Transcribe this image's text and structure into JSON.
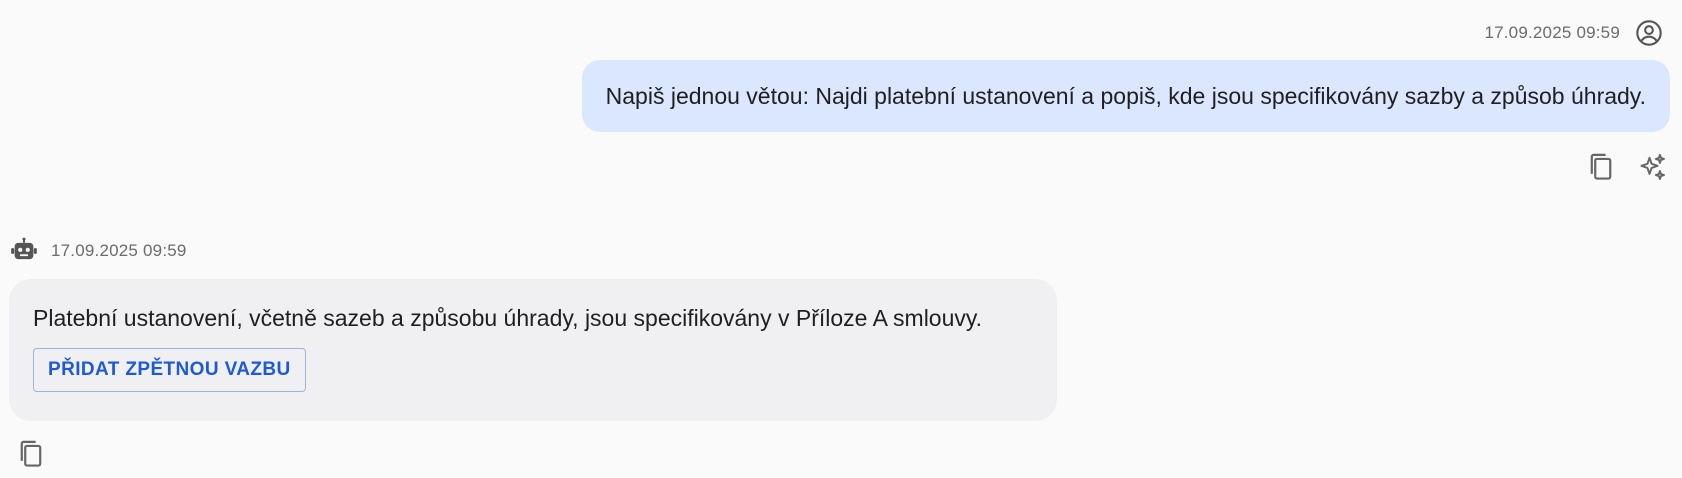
{
  "user_message": {
    "timestamp": "17.09.2025 09:59",
    "avatar_icon": "account-circle-icon",
    "text": "Napiš jednou větou: Najdi platební ustanovení a popiš, kde jsou specifikovány sazby a způsob úhrady.",
    "bubble_color": "#dbe6ff",
    "actions": [
      {
        "icon": "copy-icon"
      },
      {
        "icon": "sparkle-icon"
      }
    ]
  },
  "bot_message": {
    "timestamp": "17.09.2025 09:59",
    "avatar_icon": "robot-icon",
    "text": "Platební ustanovení, včetně sazeb a způsobu úhrady, jsou specifikovány v Příloze A smlouvy.",
    "feedback_button_label": "PŘIDAT ZPĚTNOU VAZBU",
    "bubble_color": "#f0f0f3",
    "accent_color": "#1e5ad6",
    "actions": [
      {
        "icon": "copy-icon"
      }
    ]
  }
}
